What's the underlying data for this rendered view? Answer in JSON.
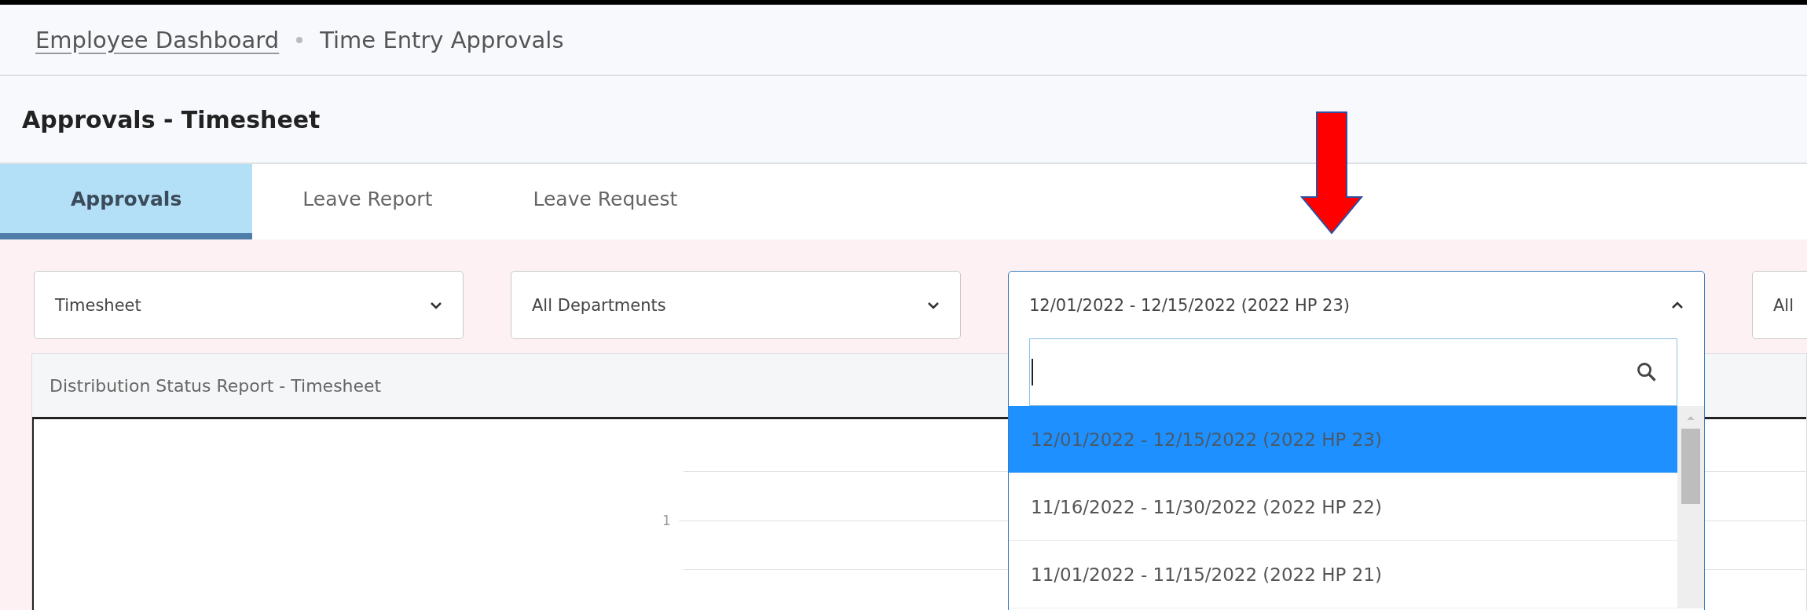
{
  "breadcrumb": [
    {
      "label": "Employee Dashboard",
      "kind": "link"
    },
    {
      "label": "Time Entry Approvals",
      "kind": "current"
    }
  ],
  "page_title": "Approvals - Timesheet",
  "tabs": [
    {
      "label": "Approvals",
      "selected": true
    },
    {
      "label": "Leave Report",
      "selected": false
    },
    {
      "label": "Leave Request",
      "selected": false
    }
  ],
  "filters": [
    {
      "value": "Timesheet",
      "expanded": false
    },
    {
      "value": "All Departments",
      "expanded": false
    },
    {
      "value": "12/01/2022 - 12/15/2022 (2022 HP 23)",
      "expanded": true,
      "options": [
        {
          "label": "12/01/2022 - 12/15/2022 (2022 HP 23)",
          "selected": true
        },
        {
          "label": "11/16/2022 - 11/30/2022 (2022 HP 22)",
          "selected": false
        },
        {
          "label": "11/01/2022 - 11/15/2022 (2022 HP 21)",
          "selected": false
        }
      ]
    },
    {
      "value": "All",
      "expanded": false
    }
  ],
  "report": {
    "title": "Distribution Status Report - Timesheet",
    "y_tick_label": "1"
  }
}
